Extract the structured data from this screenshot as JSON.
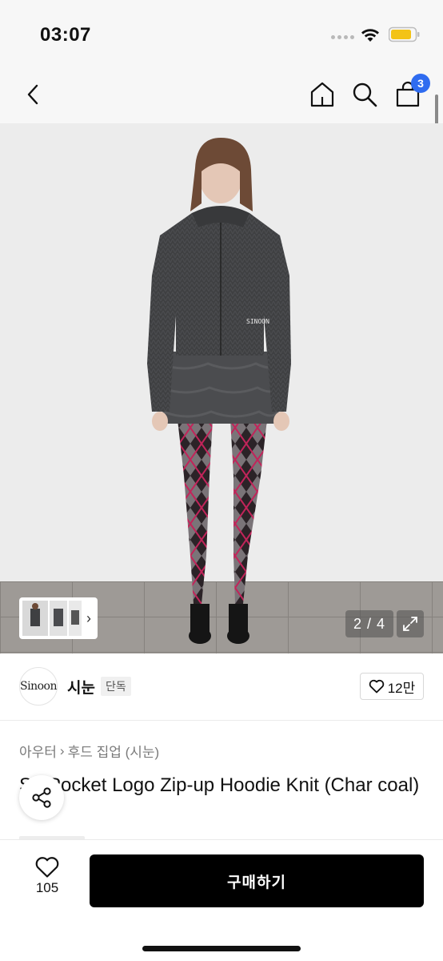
{
  "status": {
    "time": "03:07"
  },
  "nav": {
    "cart_count": "3"
  },
  "gallery": {
    "page_indicator": "2 / 4",
    "current_page": 2,
    "total_pages": 4,
    "knit_logo_text": "SINOON"
  },
  "brand": {
    "logo_text": "Sinoon",
    "name": "시눈",
    "tag": "단독",
    "likes": "12만"
  },
  "product": {
    "breadcrumb": [
      "아우터",
      "후드 집업 (시눈)"
    ],
    "title": "Sn Pocket Logo Zip-up Hoodie Knit (Char    coal)"
  },
  "bottom": {
    "wish_count": "105",
    "buy_label": "구매하기"
  },
  "colors": {
    "accent_badge": "#2f6cf0",
    "buy_button": "#000000",
    "battery": "#f3c316"
  }
}
